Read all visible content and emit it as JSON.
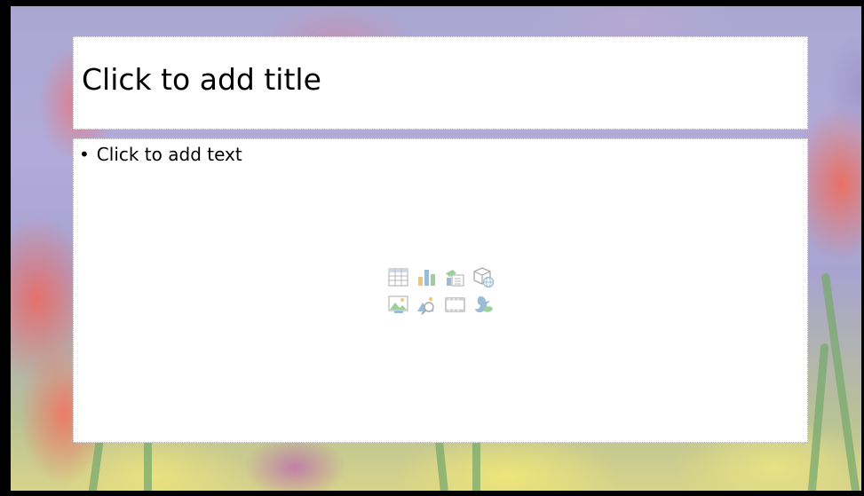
{
  "slide": {
    "title_placeholder": "Click to add title",
    "content_bullet": "•",
    "content_placeholder": "Click to add text"
  },
  "content_insert_icons": [
    "insert-table-icon",
    "insert-chart-icon",
    "insert-smartart-icon",
    "insert-3d-model-icon",
    "insert-picture-icon",
    "insert-online-picture-icon",
    "insert-video-icon",
    "insert-icons-icon"
  ],
  "colors": {
    "frame": "#000000",
    "placeholder_fill": "#ffffff",
    "icon_blue": "#9bbcd8",
    "icon_gray": "#b8b8b8",
    "icon_green": "#9ccf9c",
    "icon_orange": "#f2c47a"
  }
}
